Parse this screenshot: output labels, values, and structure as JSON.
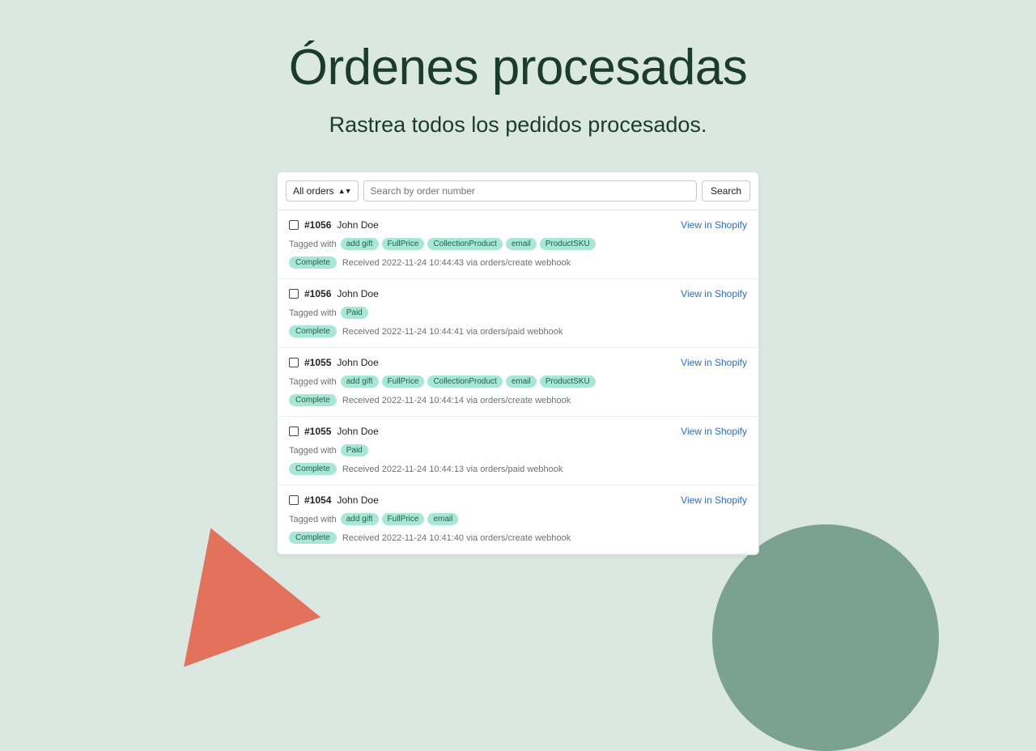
{
  "header": {
    "title": "Órdenes procesadas",
    "subtitle": "Rastrea todos los pedidos procesados."
  },
  "toolbar": {
    "filter_label": "All orders",
    "search_placeholder": "Search by order number",
    "search_button": "Search"
  },
  "labels": {
    "tagged_with": "Tagged with",
    "view_link": "View in Shopify"
  },
  "orders": [
    {
      "number": "#1056",
      "name": "John Doe",
      "tags": [
        "add gift",
        "FullPrice",
        "CollectionProduct",
        "email",
        "ProductSKU"
      ],
      "status": "Complete",
      "received": "Received 2022-11-24 10:44:43 via orders/create webhook"
    },
    {
      "number": "#1056",
      "name": "John Doe",
      "tags": [
        "Paid"
      ],
      "status": "Complete",
      "received": "Received 2022-11-24 10:44:41 via orders/paid webhook"
    },
    {
      "number": "#1055",
      "name": "John Doe",
      "tags": [
        "add gift",
        "FullPrice",
        "CollectionProduct",
        "email",
        "ProductSKU"
      ],
      "status": "Complete",
      "received": "Received 2022-11-24 10:44:14 via orders/create webhook"
    },
    {
      "number": "#1055",
      "name": "John Doe",
      "tags": [
        "Paid"
      ],
      "status": "Complete",
      "received": "Received 2022-11-24 10:44:13 via orders/paid webhook"
    },
    {
      "number": "#1054",
      "name": "John Doe",
      "tags": [
        "add gift",
        "FullPrice",
        "email"
      ],
      "status": "Complete",
      "received": "Received 2022-11-24 10:41:40 via orders/create webhook"
    }
  ]
}
